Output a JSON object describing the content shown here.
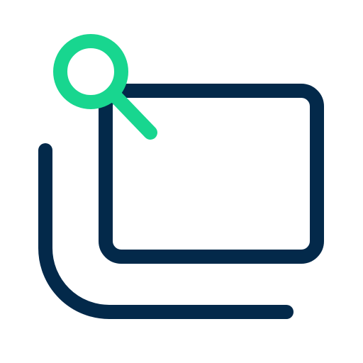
{
  "icon": {
    "name": "search-windows-icon",
    "colors": {
      "primary": "#03294A",
      "accent": "#18D68F",
      "background": "#FFFFFF"
    }
  }
}
